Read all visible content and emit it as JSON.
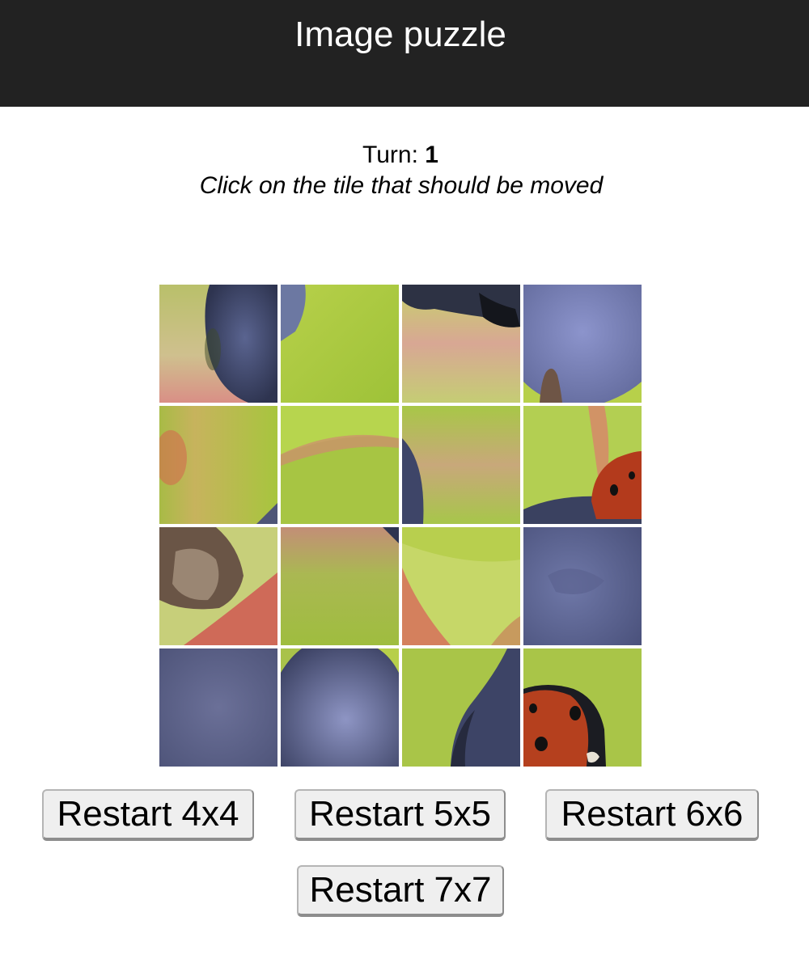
{
  "header": {
    "title": "Image puzzle"
  },
  "status": {
    "turn_label": "Turn:",
    "turn_value": "1",
    "instruction": "Click on the tile that should be moved"
  },
  "board": {
    "grid_size": 4,
    "tiles": [
      {
        "image": "berry-edge-left"
      },
      {
        "image": "green-leaf-berry-corner"
      },
      {
        "image": "berry-top-stem"
      },
      {
        "image": "berry-bottom-stem"
      },
      {
        "image": "green-red-blur"
      },
      {
        "image": "green-leaf"
      },
      {
        "image": "green-berry-edge"
      },
      {
        "image": "ladybug-top"
      },
      {
        "image": "dried-stem-red-leaf"
      },
      {
        "image": "green-red-gradient"
      },
      {
        "image": "green-red-leaf"
      },
      {
        "image": "berry-skin"
      },
      {
        "image": "berry-skin-dark"
      },
      {
        "image": "berry-skin-top"
      },
      {
        "image": "berry-right-green"
      },
      {
        "image": "ladybug-bottom"
      }
    ]
  },
  "buttons": {
    "restart_4": "Restart 4x4",
    "restart_5": "Restart 5x5",
    "restart_6": "Restart 6x6",
    "restart_7": "Restart 7x7"
  }
}
